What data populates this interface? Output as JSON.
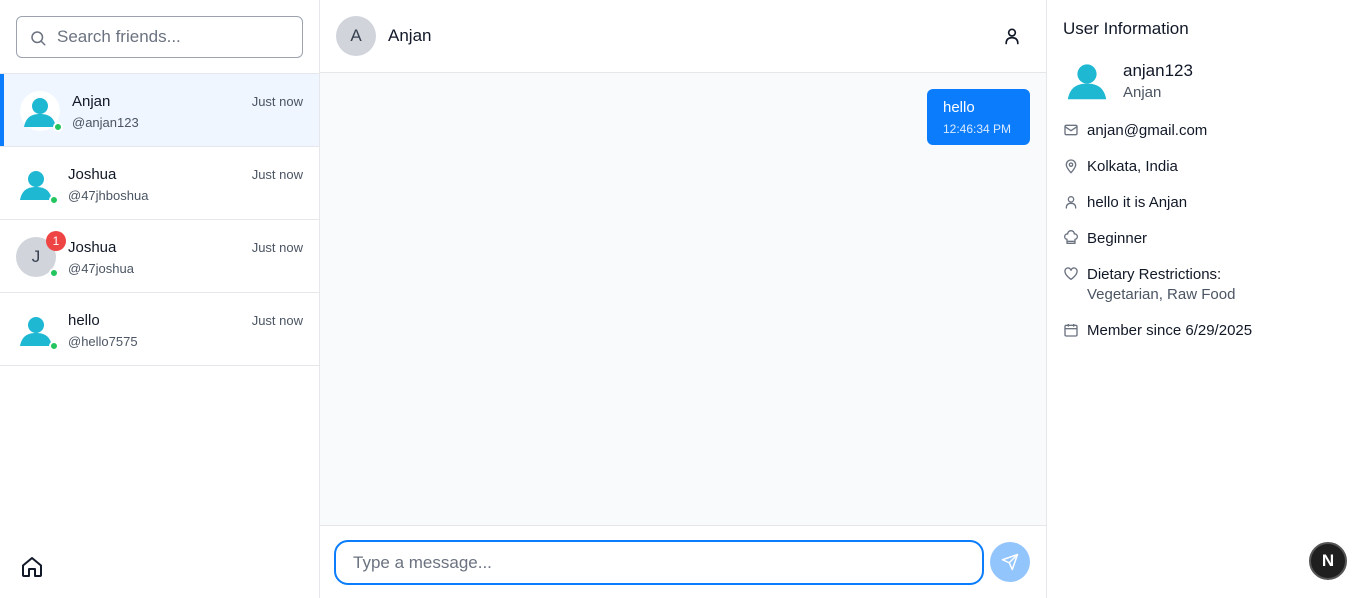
{
  "search": {
    "placeholder": "Search friends..."
  },
  "friends": [
    {
      "name": "Anjan",
      "handle": "@anjan123",
      "time": "Just now",
      "avatar": "person-icon",
      "online": true,
      "active": true
    },
    {
      "name": "Joshua",
      "handle": "@47jhboshua",
      "time": "Just now",
      "avatar": "person-icon",
      "online": true
    },
    {
      "name": "Joshua",
      "handle": "@47joshua",
      "time": "Just now",
      "avatar_letter": "J",
      "unread": "1",
      "online": true
    },
    {
      "name": "hello",
      "handle": "@hello7575",
      "time": "Just now",
      "avatar": "person-icon",
      "online": true
    }
  ],
  "chat": {
    "header": {
      "avatar_letter": "A",
      "name": "Anjan"
    },
    "messages": [
      {
        "text": "hello",
        "time": "12:46:34 PM",
        "sent": true
      }
    ],
    "composer": {
      "placeholder": "Type a message..."
    }
  },
  "info": {
    "title": "User Information",
    "username": "anjan123",
    "display_name": "Anjan",
    "email": "anjan@gmail.com",
    "location": "Kolkata, India",
    "bio": "hello it is Anjan",
    "level": "Beginner",
    "dietary_label": "Dietary Restrictions:",
    "dietary_value": "Vegetarian, Raw Food",
    "member_since": "Member since 6/29/2025"
  },
  "dev_badge": {
    "letter": "N"
  },
  "colors": {
    "accent": "#0b7dfc",
    "avatar_teal": "#1fb8d3",
    "online": "#22c55e",
    "unread": "#ef4444"
  }
}
